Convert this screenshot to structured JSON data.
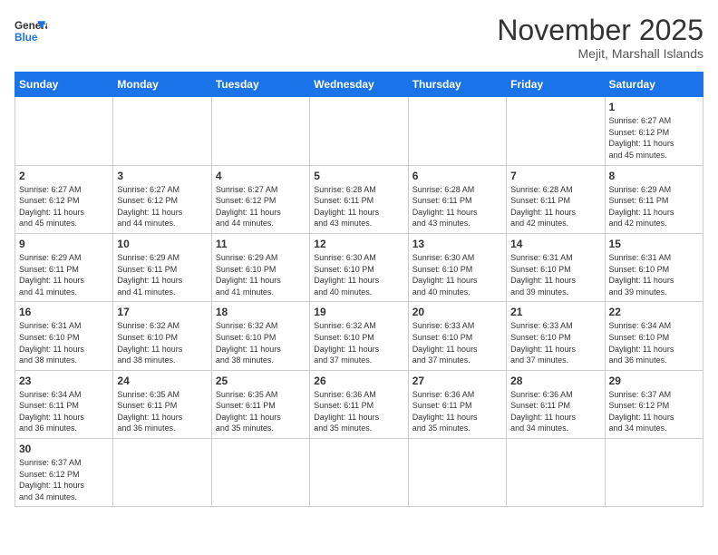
{
  "header": {
    "logo_general": "General",
    "logo_blue": "Blue",
    "month_title": "November 2025",
    "location": "Mejit, Marshall Islands"
  },
  "weekdays": [
    "Sunday",
    "Monday",
    "Tuesday",
    "Wednesday",
    "Thursday",
    "Friday",
    "Saturday"
  ],
  "days": [
    {
      "date": "",
      "info": ""
    },
    {
      "date": "",
      "info": ""
    },
    {
      "date": "",
      "info": ""
    },
    {
      "date": "",
      "info": ""
    },
    {
      "date": "",
      "info": ""
    },
    {
      "date": "",
      "info": ""
    },
    {
      "date": "1",
      "info": "Sunrise: 6:27 AM\nSunset: 6:12 PM\nDaylight: 11 hours\nand 45 minutes."
    },
    {
      "date": "2",
      "info": "Sunrise: 6:27 AM\nSunset: 6:12 PM\nDaylight: 11 hours\nand 45 minutes."
    },
    {
      "date": "3",
      "info": "Sunrise: 6:27 AM\nSunset: 6:12 PM\nDaylight: 11 hours\nand 44 minutes."
    },
    {
      "date": "4",
      "info": "Sunrise: 6:27 AM\nSunset: 6:12 PM\nDaylight: 11 hours\nand 44 minutes."
    },
    {
      "date": "5",
      "info": "Sunrise: 6:28 AM\nSunset: 6:11 PM\nDaylight: 11 hours\nand 43 minutes."
    },
    {
      "date": "6",
      "info": "Sunrise: 6:28 AM\nSunset: 6:11 PM\nDaylight: 11 hours\nand 43 minutes."
    },
    {
      "date": "7",
      "info": "Sunrise: 6:28 AM\nSunset: 6:11 PM\nDaylight: 11 hours\nand 42 minutes."
    },
    {
      "date": "8",
      "info": "Sunrise: 6:29 AM\nSunset: 6:11 PM\nDaylight: 11 hours\nand 42 minutes."
    },
    {
      "date": "9",
      "info": "Sunrise: 6:29 AM\nSunset: 6:11 PM\nDaylight: 11 hours\nand 41 minutes."
    },
    {
      "date": "10",
      "info": "Sunrise: 6:29 AM\nSunset: 6:11 PM\nDaylight: 11 hours\nand 41 minutes."
    },
    {
      "date": "11",
      "info": "Sunrise: 6:29 AM\nSunset: 6:10 PM\nDaylight: 11 hours\nand 41 minutes."
    },
    {
      "date": "12",
      "info": "Sunrise: 6:30 AM\nSunset: 6:10 PM\nDaylight: 11 hours\nand 40 minutes."
    },
    {
      "date": "13",
      "info": "Sunrise: 6:30 AM\nSunset: 6:10 PM\nDaylight: 11 hours\nand 40 minutes."
    },
    {
      "date": "14",
      "info": "Sunrise: 6:31 AM\nSunset: 6:10 PM\nDaylight: 11 hours\nand 39 minutes."
    },
    {
      "date": "15",
      "info": "Sunrise: 6:31 AM\nSunset: 6:10 PM\nDaylight: 11 hours\nand 39 minutes."
    },
    {
      "date": "16",
      "info": "Sunrise: 6:31 AM\nSunset: 6:10 PM\nDaylight: 11 hours\nand 38 minutes."
    },
    {
      "date": "17",
      "info": "Sunrise: 6:32 AM\nSunset: 6:10 PM\nDaylight: 11 hours\nand 38 minutes."
    },
    {
      "date": "18",
      "info": "Sunrise: 6:32 AM\nSunset: 6:10 PM\nDaylight: 11 hours\nand 38 minutes."
    },
    {
      "date": "19",
      "info": "Sunrise: 6:32 AM\nSunset: 6:10 PM\nDaylight: 11 hours\nand 37 minutes."
    },
    {
      "date": "20",
      "info": "Sunrise: 6:33 AM\nSunset: 6:10 PM\nDaylight: 11 hours\nand 37 minutes."
    },
    {
      "date": "21",
      "info": "Sunrise: 6:33 AM\nSunset: 6:10 PM\nDaylight: 11 hours\nand 37 minutes."
    },
    {
      "date": "22",
      "info": "Sunrise: 6:34 AM\nSunset: 6:10 PM\nDaylight: 11 hours\nand 36 minutes."
    },
    {
      "date": "23",
      "info": "Sunrise: 6:34 AM\nSunset: 6:11 PM\nDaylight: 11 hours\nand 36 minutes."
    },
    {
      "date": "24",
      "info": "Sunrise: 6:35 AM\nSunset: 6:11 PM\nDaylight: 11 hours\nand 36 minutes."
    },
    {
      "date": "25",
      "info": "Sunrise: 6:35 AM\nSunset: 6:11 PM\nDaylight: 11 hours\nand 35 minutes."
    },
    {
      "date": "26",
      "info": "Sunrise: 6:36 AM\nSunset: 6:11 PM\nDaylight: 11 hours\nand 35 minutes."
    },
    {
      "date": "27",
      "info": "Sunrise: 6:36 AM\nSunset: 6:11 PM\nDaylight: 11 hours\nand 35 minutes."
    },
    {
      "date": "28",
      "info": "Sunrise: 6:36 AM\nSunset: 6:11 PM\nDaylight: 11 hours\nand 34 minutes."
    },
    {
      "date": "29",
      "info": "Sunrise: 6:37 AM\nSunset: 6:12 PM\nDaylight: 11 hours\nand 34 minutes."
    },
    {
      "date": "30",
      "info": "Sunrise: 6:37 AM\nSunset: 6:12 PM\nDaylight: 11 hours\nand 34 minutes."
    },
    {
      "date": "",
      "info": ""
    },
    {
      "date": "",
      "info": ""
    },
    {
      "date": "",
      "info": ""
    },
    {
      "date": "",
      "info": ""
    },
    {
      "date": "",
      "info": ""
    },
    {
      "date": "",
      "info": ""
    }
  ]
}
